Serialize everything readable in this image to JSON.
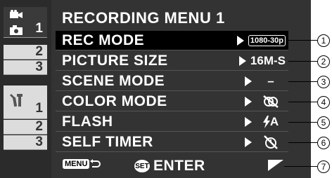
{
  "sidebar": {
    "tab1_num": "1",
    "tab2_num": "2",
    "tab3_num": "3",
    "tab4_num": "1",
    "tab5_num": "2",
    "tab6_num": "3"
  },
  "menu": {
    "title": "RECORDING MENU 1",
    "items": [
      {
        "label": "REC MODE",
        "value": "1080-30p",
        "value_icon": "resolution-badge"
      },
      {
        "label": "PICTURE SIZE",
        "value": "16M-S",
        "value_icon": "picture-size-indicator"
      },
      {
        "label": "SCENE MODE",
        "value": "–",
        "value_icon": "dash"
      },
      {
        "label": "COLOR MODE",
        "value": "",
        "value_icon": "color-off-icon"
      },
      {
        "label": "FLASH",
        "value": "A",
        "value_icon": "flash-auto-icon"
      },
      {
        "label": "SELF TIMER",
        "value": "",
        "value_icon": "self-timer-off-icon"
      }
    ]
  },
  "footer": {
    "menu_label": "MENU",
    "set_label": "SET",
    "enter_label": "ENTER"
  },
  "callouts": [
    "1",
    "2",
    "3",
    "4",
    "5",
    "6",
    "7"
  ],
  "colors": {
    "screen_bg": "#333333",
    "selected_row": "#000000",
    "tab_bg": "#dcdcdc",
    "text": "#ffffff"
  }
}
